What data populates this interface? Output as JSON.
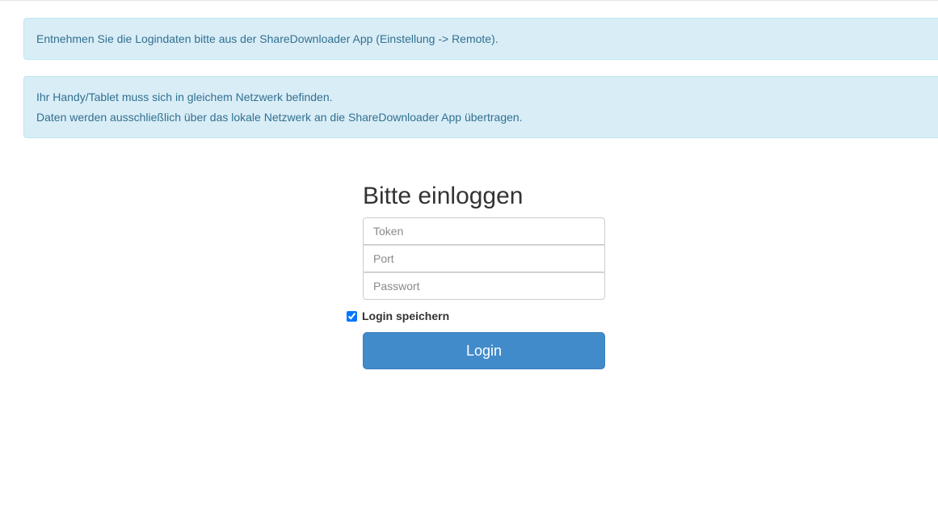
{
  "info_alerts": {
    "login_hint": "Entnehmen Sie die Logindaten bitte aus der ShareDownloader App (Einstellung -> Remote).",
    "network_hint_line1": "Ihr Handy/Tablet muss sich in gleichem Netzwerk befinden.",
    "network_hint_line2": "Daten werden ausschließlich über das lokale Netzwerk an die ShareDownloader App übertragen."
  },
  "login_form": {
    "heading": "Bitte einloggen",
    "token_placeholder": "Token",
    "token_value": "",
    "port_placeholder": "Port",
    "port_value": "",
    "password_placeholder": "Passwort",
    "password_value": "",
    "remember_label": "Login speichern",
    "remember_checked": true,
    "submit_label": "Login"
  },
  "colors": {
    "alert_background": "#d9edf7",
    "alert_text": "#31708f",
    "button_primary": "#428bca"
  }
}
